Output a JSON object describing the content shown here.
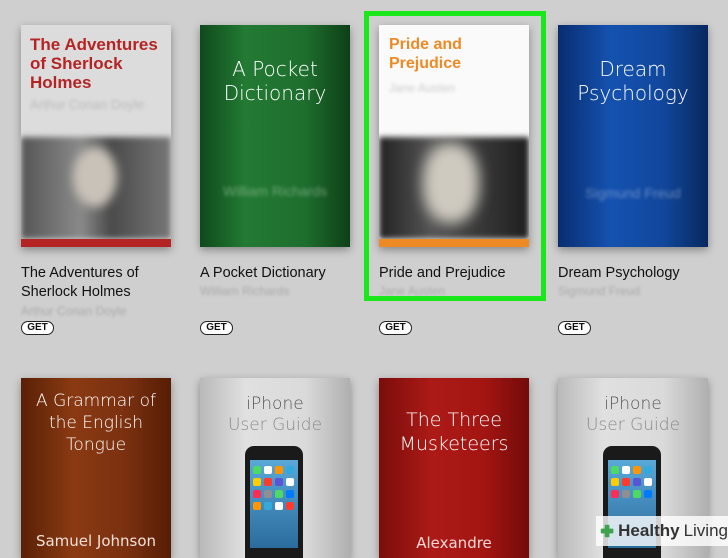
{
  "books": [
    {
      "cover_title": "The Adventures of Sherlock Holmes",
      "cover_author": "Arthur Conan Doyle",
      "label_line1": "The Adventures of",
      "label_line2": "Sherlock Holmes",
      "author": "Arthur Conan Doyle",
      "button": "GET"
    },
    {
      "cover_title_line1": "A Pocket",
      "cover_title_line2": "Dictionary",
      "cover_author": "William Richards",
      "label": "A Pocket Dictionary",
      "author": "William Richards",
      "button": "GET"
    },
    {
      "cover_title_line1": "Pride and",
      "cover_title_line2": "Prejudice",
      "cover_author": "Jane Austen",
      "label": "Pride and Prejudice",
      "author": "Jane Austen",
      "button": "GET"
    },
    {
      "cover_title_line1": "Dream",
      "cover_title_line2": "Psychology",
      "cover_author": "Sigmund Freud",
      "label": "Dream Psychology",
      "author": "Sigmund Freud",
      "button": "GET"
    },
    {
      "cover_title_line1": "A Grammar of",
      "cover_title_line2": "the English",
      "cover_title_line3": "Tongue",
      "cover_author": "Samuel Johnson"
    },
    {
      "cover_title_line1": "iPhone",
      "cover_title_line2": "User Guide"
    },
    {
      "cover_title_line1": "The Three",
      "cover_title_line2": "Musketeers",
      "cover_author": "Alexandre"
    },
    {
      "cover_title_line1": "iPhone",
      "cover_title_line2": "User Guide"
    }
  ],
  "watermark": {
    "brand": "Healthy",
    "brand2": "Living"
  },
  "colors": {
    "highlight": "#1be81b",
    "sherlock_red": "#b52424",
    "pride_orange": "#ee8a24",
    "dictionary_green": "#1d6b2c",
    "dream_blue": "#0f3f93",
    "grammar_brown": "#7a3010",
    "musketeers_red": "#a31512"
  }
}
